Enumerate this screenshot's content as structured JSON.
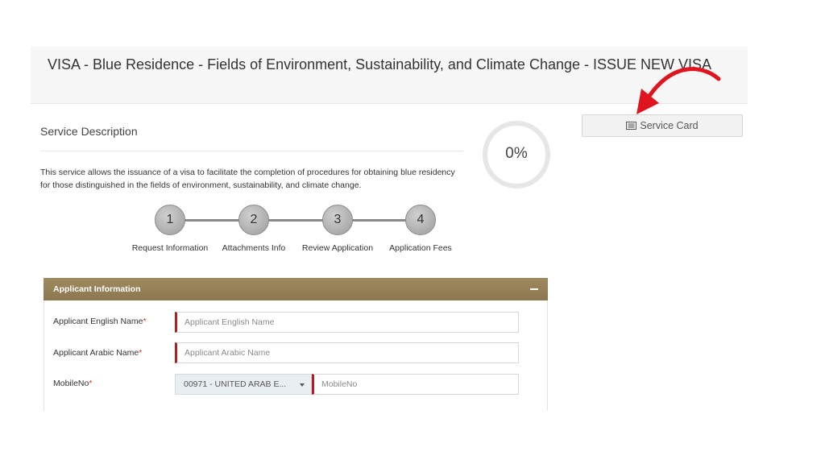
{
  "header": {
    "title": "VISA - Blue Residence - Fields of Environment, Sustainability, and Climate Change - ISSUE NEW VISA"
  },
  "service": {
    "section_title": "Service Description",
    "description": "This service allows the issuance of a visa to facilitate the completion of procedures for obtaining blue residency for those distinguished in the fields of environment, sustainability, and climate change.",
    "progress_text": "0%",
    "progress_value": 0,
    "service_card_label": "Service Card",
    "service_card_icon": "list-card-icon"
  },
  "steps": [
    {
      "number": "1",
      "label": "Request Information"
    },
    {
      "number": "2",
      "label": "Attachments Info"
    },
    {
      "number": "3",
      "label": "Review Application"
    },
    {
      "number": "4",
      "label": "Application Fees"
    }
  ],
  "applicant": {
    "panel_title": "Applicant Information",
    "english_name": {
      "label": "Applicant English Name",
      "required": "*",
      "placeholder": "Applicant English Name",
      "value": ""
    },
    "arabic_name": {
      "label": "Applicant Arabic Name",
      "required": "*",
      "placeholder": "Applicant Arabic Name",
      "value": ""
    },
    "mobile": {
      "label": "MobileNo",
      "required": "*",
      "country_selected": "00971 - UNITED ARAB E...",
      "placeholder": "MobileNo",
      "value": ""
    }
  },
  "colors": {
    "panel_header": "#9a845a",
    "required_marker": "#b01c24",
    "annotation_arrow": "#e0141e"
  }
}
